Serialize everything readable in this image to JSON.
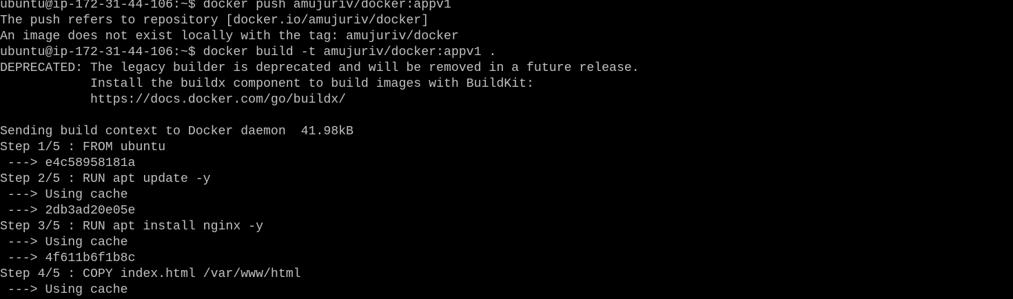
{
  "terminal": {
    "colors": {
      "background": "#000000",
      "foreground": "#c0c0c0"
    },
    "lines": [
      "ubuntu@ip-172-31-44-106:~$ docker push amujuriv/docker:appv1",
      "The push refers to repository [docker.io/amujuriv/docker]",
      "An image does not exist locally with the tag: amujuriv/docker",
      "ubuntu@ip-172-31-44-106:~$ docker build -t amujuriv/docker:appv1 .",
      "DEPRECATED: The legacy builder is deprecated and will be removed in a future release.",
      "            Install the buildx component to build images with BuildKit:",
      "            https://docs.docker.com/go/buildx/",
      "",
      "Sending build context to Docker daemon  41.98kB",
      "Step 1/5 : FROM ubuntu",
      " ---> e4c58958181a",
      "Step 2/5 : RUN apt update -y",
      " ---> Using cache",
      " ---> 2db3ad20e05e",
      "Step 3/5 : RUN apt install nginx -y",
      " ---> Using cache",
      " ---> 4f611b6f1b8c",
      "Step 4/5 : COPY index.html /var/www/html",
      " ---> Using cache"
    ]
  }
}
